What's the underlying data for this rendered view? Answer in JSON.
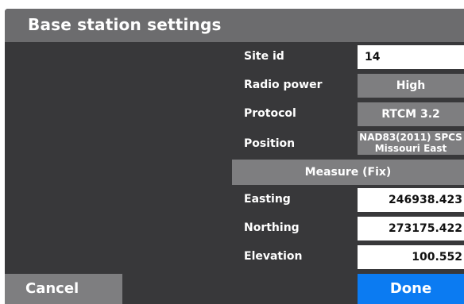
{
  "dialog": {
    "title": "Base station settings",
    "accent_color": "#0b7bf2"
  },
  "fields": {
    "site_id": {
      "label": "Site id",
      "value": "14"
    },
    "radio_power": {
      "label": "Radio power",
      "value": "High"
    },
    "protocol": {
      "label": "Protocol",
      "value": "RTCM 3.2"
    },
    "position": {
      "label": "Position",
      "value_line1": "NAD83(2011) SPCS",
      "value_line2": "Missouri East"
    },
    "easting": {
      "label": "Easting",
      "value": "246938.423"
    },
    "northing": {
      "label": "Northing",
      "value": "273175.422"
    },
    "elevation": {
      "label": "Elevation",
      "value": "100.552"
    }
  },
  "buttons": {
    "measure": "Measure (Fix)",
    "cancel": "Cancel",
    "done": "Done"
  }
}
